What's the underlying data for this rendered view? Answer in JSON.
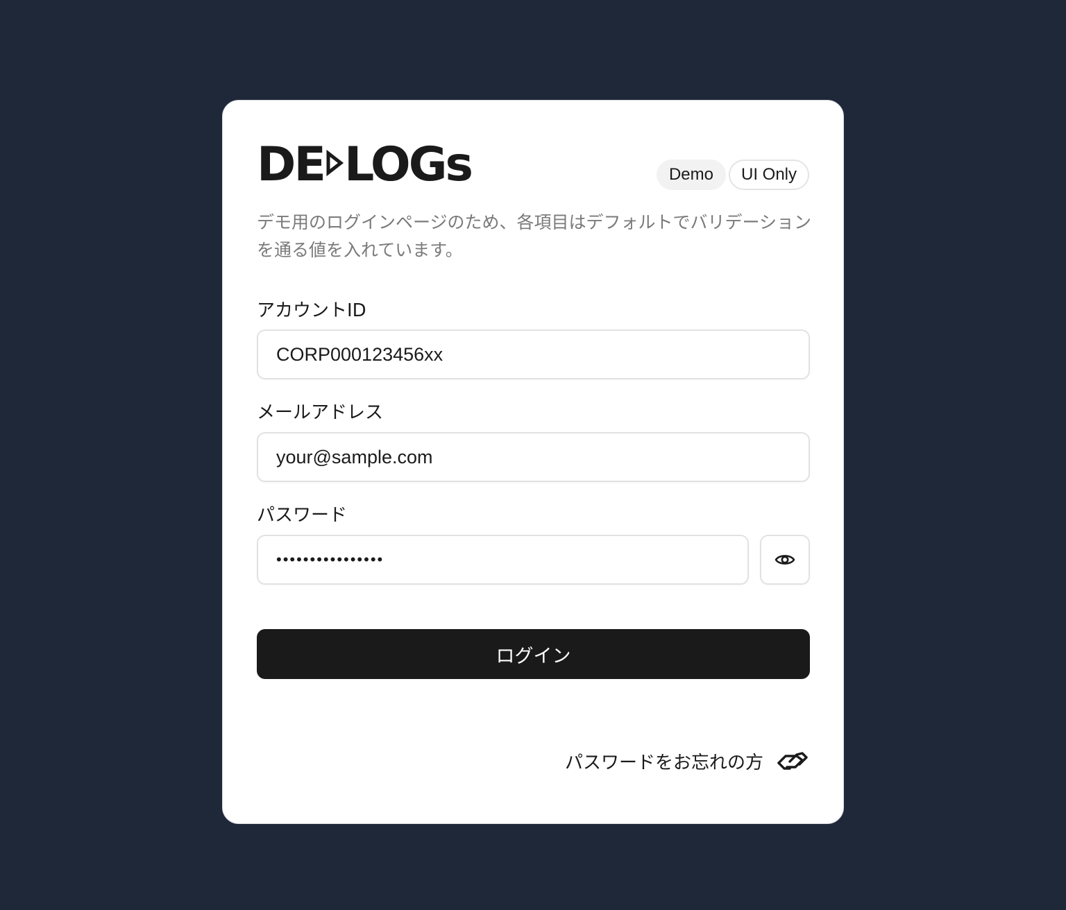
{
  "brand": {
    "logo_text": "DE LOGs"
  },
  "badges": {
    "demo": "Demo",
    "ui_only": "UI Only"
  },
  "description": "デモ用のログインページのため、各項目はデフォルトでバリデーションを通る値を入れています。",
  "form": {
    "account_id": {
      "label": "アカウントID",
      "value": "CORP000123456xx"
    },
    "email": {
      "label": "メールアドレス",
      "value": "your@sample.com"
    },
    "password": {
      "label": "パスワード",
      "masked_value": "••••••••••••••••"
    },
    "submit_label": "ログイン"
  },
  "forgot_password": {
    "label": "パスワードをお忘れの方"
  },
  "icons": {
    "toggle_password": "eye-icon",
    "forgot_password": "handshake-icon"
  },
  "colors": {
    "background": "#1f2838",
    "card": "#ffffff",
    "primary_button": "#1a1a1a",
    "muted_text": "#7a7a7a"
  }
}
